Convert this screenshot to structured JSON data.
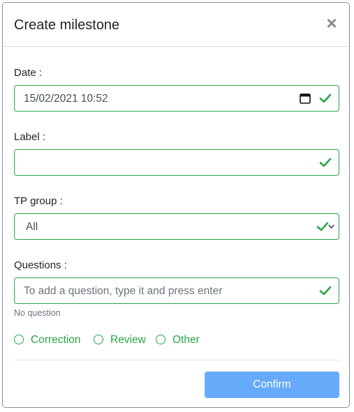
{
  "dialog": {
    "title": "Create milestone",
    "close_glyph": "×"
  },
  "date": {
    "label": "Date :",
    "value": "15/02/2021  10:52"
  },
  "label_field": {
    "label": "Label :",
    "value": ""
  },
  "tp_group": {
    "label": "TP group :",
    "selected": "All"
  },
  "questions": {
    "label": "Questions :",
    "placeholder": "To add a question, type it and press enter",
    "help": "No question"
  },
  "type_options": [
    {
      "label": "Correction"
    },
    {
      "label": "Review"
    },
    {
      "label": "Other"
    }
  ],
  "actions": {
    "confirm_label": "Confirm"
  },
  "colors": {
    "valid": "#28a745",
    "confirm_bg": "#66aaf9"
  }
}
